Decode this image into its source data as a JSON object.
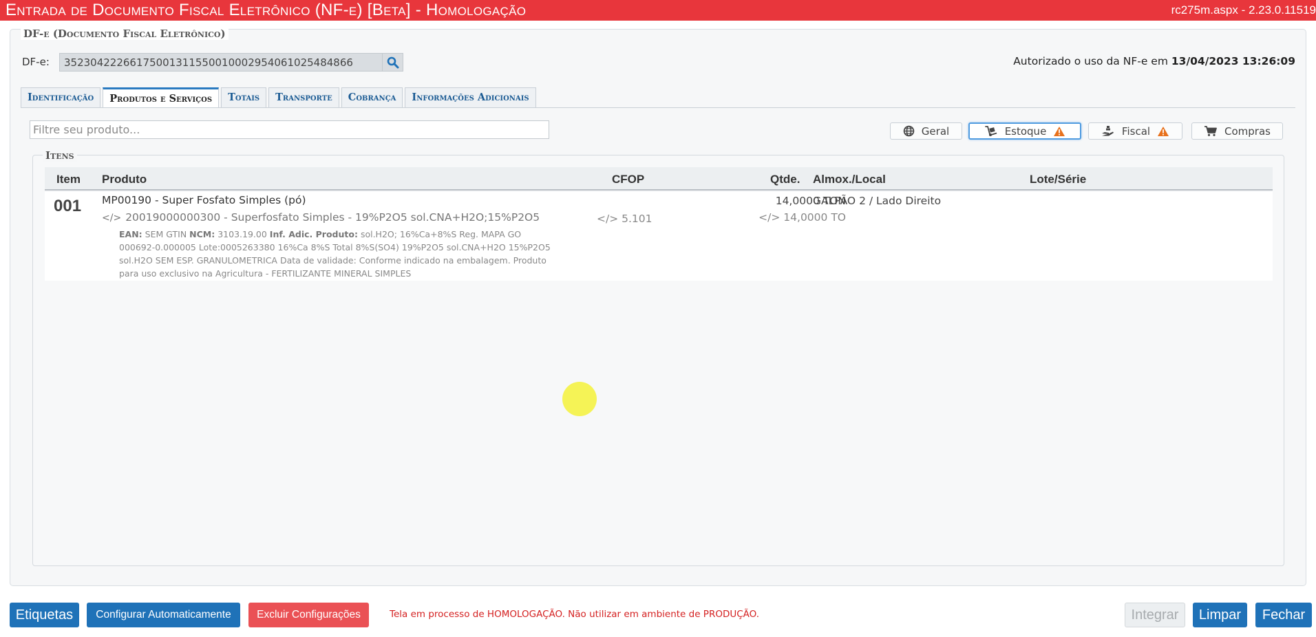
{
  "titlebar": {
    "title": "Entrada de Documento Fiscal Eletrônico (NF-e) [Beta]  - Homologação",
    "version": "rc275m.aspx - 2.23.0.11519"
  },
  "dfe": {
    "legend": "DF-e (Documento Fiscal Eletrônico)",
    "label": "DF-e:",
    "key": "35230422266175001311550010002954061025484866",
    "authorized_prefix": "Autorizado o uso da NF-e em",
    "authorized_datetime": "13/04/2023 13:26:09"
  },
  "tabs": [
    {
      "label": "Identificação",
      "active": false
    },
    {
      "label": "Produtos e Serviços",
      "active": true
    },
    {
      "label": "Totais",
      "active": false
    },
    {
      "label": "Transporte",
      "active": false
    },
    {
      "label": "Cobrança",
      "active": false
    },
    {
      "label": "Informações Adicionais",
      "active": false
    }
  ],
  "filter": {
    "placeholder": "Filtre seu produto..."
  },
  "view_buttons": [
    {
      "label": "Geral",
      "icon": "globe-icon",
      "warning": false,
      "active": false
    },
    {
      "label": "Estoque",
      "icon": "hand-truck-icon",
      "warning": true,
      "active": true
    },
    {
      "label": "Fiscal",
      "icon": "hand-coins-icon",
      "warning": true,
      "active": false
    },
    {
      "label": "Compras",
      "icon": "cart-icon",
      "warning": false,
      "active": false
    }
  ],
  "items": {
    "legend": "Itens",
    "columns": {
      "item": "Item",
      "produto": "Produto",
      "cfop": "CFOP",
      "qtde": "Qtde.",
      "almox": "Almox./Local",
      "lote": "Lote/Série"
    },
    "rows": [
      {
        "item": "001",
        "product_name": "MP00190 - Super Fosfato Simples (pó)",
        "product_code_desc": "20019000000300 - Superfosfato Simples - 19%P2O5 sol.CNA+H2O;15%P2O5",
        "ean_label": "EAN:",
        "ean": "SEM GTIN",
        "ncm_label": "NCM:",
        "ncm": "3103.19.00",
        "inf_label": "Inf. Adic. Produto:",
        "inf": "sol.H2O; 16%Ca+8%S Reg. MAPA GO 000692-0.000005 Lote:0005263380 16%Ca 8%S Total 8%S(SO4) 19%P2O5 sol.CNA+H2O 15%P2O5 sol.H2O SEM ESP. GRANULOMETRICA Data de validade: Conforme indicado na embalagem. Produto para uso exclusivo na Agricultura - FERTILIZANTE MINERAL SIMPLES",
        "cfop": "5.101",
        "qty": "14,0000 TON",
        "qty_secondary": "14,0000 TO",
        "almox": "GALPÃO 2 / Lado Direito",
        "lote": ""
      }
    ]
  },
  "footer": {
    "etiquetas": "Etiquetas",
    "configurar": "Configurar Automaticamente",
    "excluir": "Excluir Configurações",
    "message": "Tela em processo de HOMOLOGAÇÃO. Não utilizar em ambiente de PRODUÇÃO.",
    "integrar": "Integrar",
    "limpar": "Limpar",
    "fechar": "Fechar"
  },
  "colors": {
    "titlebar": "#e8363c",
    "primary_button": "#1f72b8",
    "danger_button": "#ea5155",
    "warning_icon": "#e8711c"
  }
}
